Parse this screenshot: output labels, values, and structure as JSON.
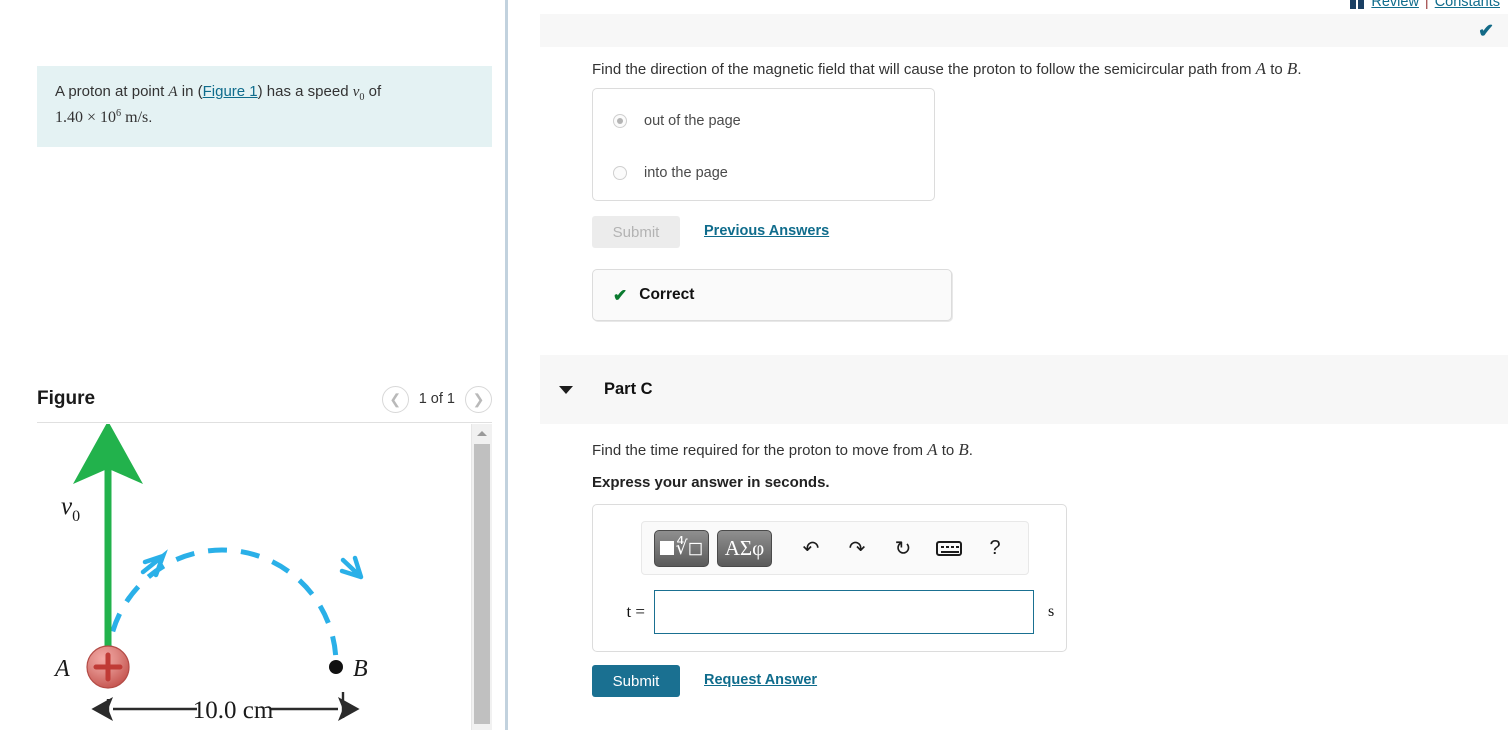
{
  "header": {
    "book_icon": "book-icon",
    "review_label": "Review",
    "separator": "|",
    "constants_label": "Constants"
  },
  "left_pane": {
    "problem": {
      "text_1": "A proton at point ",
      "var_a": "A",
      "text_2": " in (",
      "figure_link": "Figure 1",
      "text_3": ") has a speed ",
      "var_v": "v",
      "var_v_sub": "0",
      "text_4": " of ",
      "value_mantissa": "1.40 × 10",
      "value_exponent": "6",
      "value_units": " m/s",
      "period": "."
    },
    "figure": {
      "title": "Figure",
      "prev_icon": "chevron-left-icon",
      "next_icon": "chevron-right-icon",
      "counter": "1 of 1",
      "scroll_up_icon": "caret-up-icon",
      "diagram": {
        "label_a": "A",
        "label_b": "B",
        "label_v0_var": "v",
        "label_v0_sub": "0",
        "dimension_label": "10.0 cm",
        "charge_sign": "+",
        "arrow_color": "#22b24c",
        "path_color": "#2ab0e8",
        "charge_color": "#d9534f"
      }
    }
  },
  "right_pane": {
    "part_b": {
      "status_icon": "check-icon",
      "question": {
        "text_1": "Find the direction of the magnetic field that will cause the proton to follow the semicircular path from ",
        "var_a": "A",
        "text_2": " to ",
        "var_b": "B",
        "period": "."
      },
      "options": [
        {
          "label": "out of the page",
          "selected": true
        },
        {
          "label": "into the page",
          "selected": false
        }
      ],
      "submit_label": "Submit",
      "previous_answers_label": "Previous Answers",
      "feedback_icon": "check-icon",
      "feedback_label": "Correct"
    },
    "part_c": {
      "toggle_icon": "caret-down-icon",
      "title": "Part C",
      "question": {
        "text_1": "Find the time required for the proton to move from ",
        "var_a": "A",
        "text_2": " to ",
        "var_b": "B",
        "period": "."
      },
      "instruction": "Express your answer in seconds.",
      "toolbar": {
        "template_button": {
          "icon": "math-template-icon",
          "square": "■",
          "radical": "√"
        },
        "greek_button": {
          "icon": "greek-symbols-icon",
          "label": "ΑΣφ"
        },
        "undo": {
          "icon": "undo-icon",
          "glyph": "↶"
        },
        "redo": {
          "icon": "redo-icon",
          "glyph": "↷"
        },
        "reset": {
          "icon": "reset-icon",
          "glyph": "↻"
        },
        "keyboard": {
          "icon": "keyboard-icon"
        },
        "help": {
          "icon": "help-icon",
          "glyph": "?"
        }
      },
      "answer": {
        "variable_label": "t =",
        "value": "",
        "placeholder": "",
        "unit": "s"
      },
      "submit_label": "Submit",
      "request_answer_label": "Request Answer"
    }
  }
}
